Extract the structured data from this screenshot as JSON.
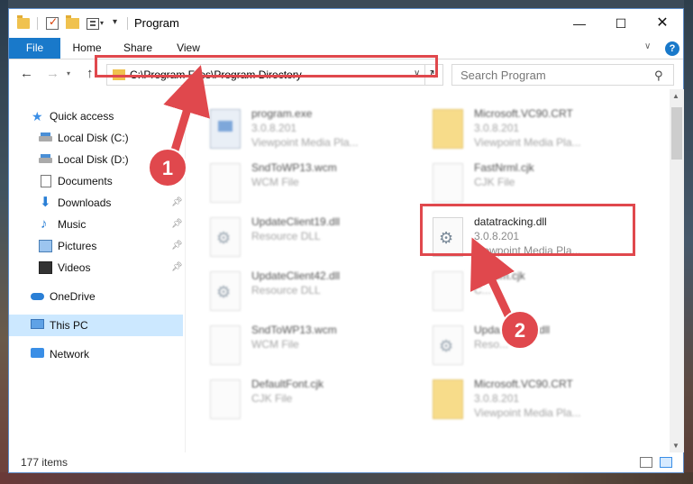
{
  "window": {
    "title": "Program"
  },
  "ribbon": {
    "tabs": [
      "File",
      "Home",
      "Share",
      "View"
    ]
  },
  "nav": {
    "address": "C:\\Program Files\\Program Directory",
    "search_placeholder": "Search Program"
  },
  "sidebar": {
    "items": [
      {
        "label": "Quick access",
        "icon": "star-icon",
        "pinned": false
      },
      {
        "label": "Local Disk (C:)",
        "icon": "disk-icon",
        "pinned": false
      },
      {
        "label": "Local Disk (D:)",
        "icon": "disk-icon",
        "pinned": false
      },
      {
        "label": "Documents",
        "icon": "documents-icon",
        "pinned": false
      },
      {
        "label": "Downloads",
        "icon": "download-icon",
        "pinned": true
      },
      {
        "label": "Music",
        "icon": "music-icon",
        "pinned": true
      },
      {
        "label": "Pictures",
        "icon": "pictures-icon",
        "pinned": true
      },
      {
        "label": "Videos",
        "icon": "videos-icon",
        "pinned": true
      },
      {
        "label": "OneDrive",
        "icon": "cloud-icon",
        "pinned": false
      },
      {
        "label": "This PC",
        "icon": "pc-icon",
        "pinned": false
      },
      {
        "label": "Network",
        "icon": "network-icon",
        "pinned": false
      }
    ]
  },
  "files": {
    "col1": [
      {
        "name": "program.exe",
        "l2": "3.0.8.201",
        "l3": "Viewpoint Media Pla...",
        "icon": "exe"
      },
      {
        "name": "SndToWP13.wcm",
        "l2": "WCM File",
        "l3": "",
        "icon": "doc"
      },
      {
        "name": "UpdateClient19.dll",
        "l2": "Resource DLL",
        "l3": "",
        "icon": "gear"
      },
      {
        "name": "UpdateClient42.dll",
        "l2": "Resource DLL",
        "l3": "",
        "icon": "gear"
      },
      {
        "name": "SndToWP13.wcm",
        "l2": "WCM File",
        "l3": "",
        "icon": "doc"
      },
      {
        "name": "DefaultFont.cjk",
        "l2": "CJK File",
        "l3": "",
        "icon": "doc"
      }
    ],
    "col2": [
      {
        "name": "Microsoft.VC90.CRT",
        "l2": "3.0.8.201",
        "l3": "Viewpoint Media Pla...",
        "icon": "folder"
      },
      {
        "name": "FastNrml.cjk",
        "l2": "CJK File",
        "l3": "",
        "icon": "doc"
      },
      {
        "name": "datatracking.dll",
        "l2": "3.0.8.201",
        "l3": "Viewpoint Media Pla...",
        "icon": "gear"
      },
      {
        "name": "B...rom.cjk",
        "l2": "C...",
        "l3": "",
        "icon": "doc"
      },
      {
        "name": "Upda...ent65.dll",
        "l2": "Reso...",
        "l3": "",
        "icon": "gear"
      },
      {
        "name": "Microsoft.VC90.CRT",
        "l2": "3.0.8.201",
        "l3": "Viewpoint Media Pla...",
        "icon": "folder"
      }
    ]
  },
  "status": {
    "count": "177 items"
  },
  "annotations": {
    "badge1": "1",
    "badge2": "2",
    "color": "#e0484d"
  }
}
